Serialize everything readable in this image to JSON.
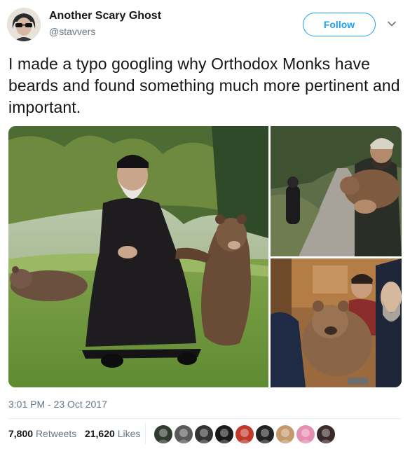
{
  "tweet": {
    "display_name": "Another Scary Ghost",
    "handle": "@stavvers",
    "follow_label": "Follow",
    "text": "I made a typo googling why Orthodox Monks have beards and found something much more pertinent and important.",
    "timestamp": "3:01 PM - 23 Oct 2017",
    "retweets_count": "7,800",
    "retweets_label": "Retweets",
    "likes_count": "21,620",
    "likes_label": "Likes"
  },
  "colors": {
    "accent": "#1da1f2",
    "secondary_text": "#657786",
    "primary_text": "#14171a",
    "divider": "#e6ecf0"
  },
  "icons": {
    "menu": "chevron-down-icon"
  },
  "liker_avatars": [
    {
      "color": "#2f3b2f"
    },
    {
      "color": "#5a5a5a"
    },
    {
      "color": "#333333"
    },
    {
      "color": "#1a1a1a"
    },
    {
      "color": "#c0392b"
    },
    {
      "color": "#222222"
    },
    {
      "color": "#c49a6c"
    },
    {
      "color": "#e58fb0"
    },
    {
      "color": "#3b2a2a"
    }
  ]
}
